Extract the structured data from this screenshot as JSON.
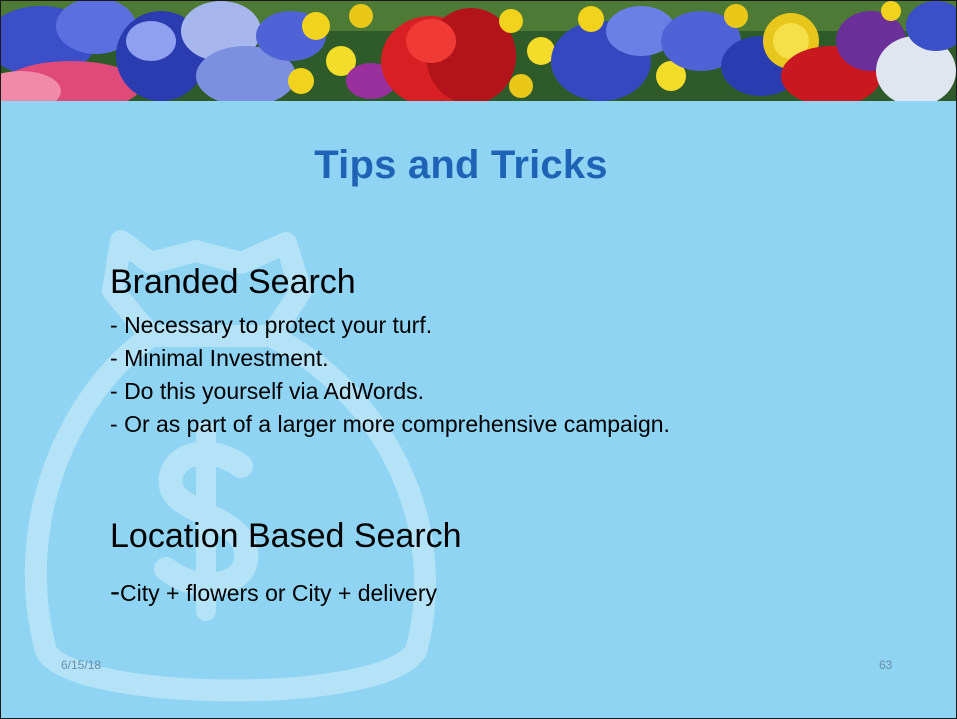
{
  "slide": {
    "title": "Tips and Tricks",
    "sections": [
      {
        "heading": "Branded Search",
        "bullets": [
          "Necessary to protect your turf.",
          "Minimal Investment.",
          "Do this yourself via AdWords.",
          "Or as part of a larger more comprehensive campaign."
        ]
      },
      {
        "heading": "Location Based Search",
        "sub_dash": "-",
        "sub_text": "City + flowers or City + delivery"
      }
    ],
    "footer": {
      "date": "6/15/18",
      "page_number": "63"
    }
  },
  "colors": {
    "background": "#8fd4f3",
    "title": "#1f63b6",
    "body_text": "#000000",
    "footer_text": "#6b8fa8",
    "watermark": "#b4e2f7"
  },
  "icons": [
    "money-bag-icon",
    "flower-banner-image"
  ]
}
